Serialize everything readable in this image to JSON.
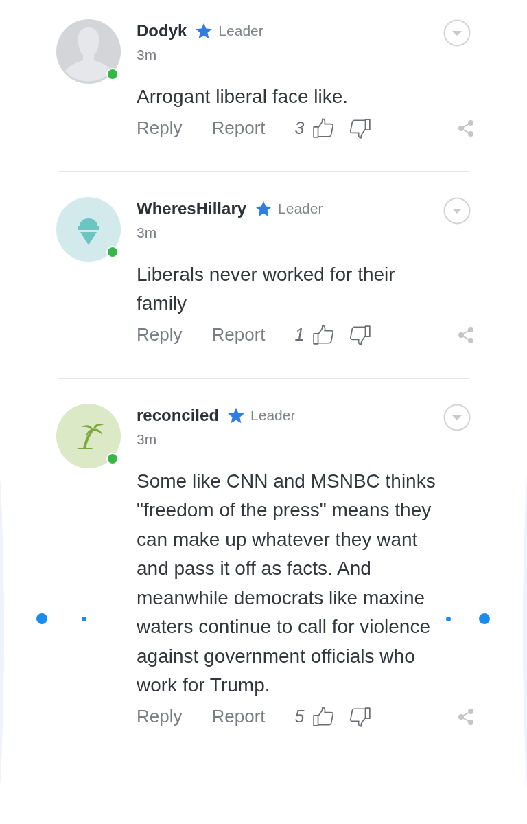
{
  "comments": [
    {
      "avatar": {
        "kind": "silhouette"
      },
      "online": true,
      "username": "Dodyk",
      "badge": "Leader",
      "time": "3m",
      "text": "Arrogant liberal face like.",
      "actions": [
        "Reply",
        "Report"
      ],
      "votes": "3"
    },
    {
      "avatar": {
        "kind": "ice-cream"
      },
      "online": true,
      "username": "WheresHillary",
      "badge": "Leader",
      "time": "3m",
      "text": "Liberals never worked for their family",
      "actions": [
        "Reply",
        "Report"
      ],
      "votes": "1"
    },
    {
      "avatar": {
        "kind": "palm-tree"
      },
      "online": true,
      "username": "reconciled",
      "badge": "Leader",
      "time": "3m",
      "text": "Some like CNN and MSNBC thinks \"freedom of the press\" means they can make up whatever they want and pass it off as facts.  And meanwhile democrats like maxine waters continue to call for violence against government officials who work for Trump.",
      "actions": [
        "Reply",
        "Report"
      ],
      "votes": "5"
    }
  ]
}
